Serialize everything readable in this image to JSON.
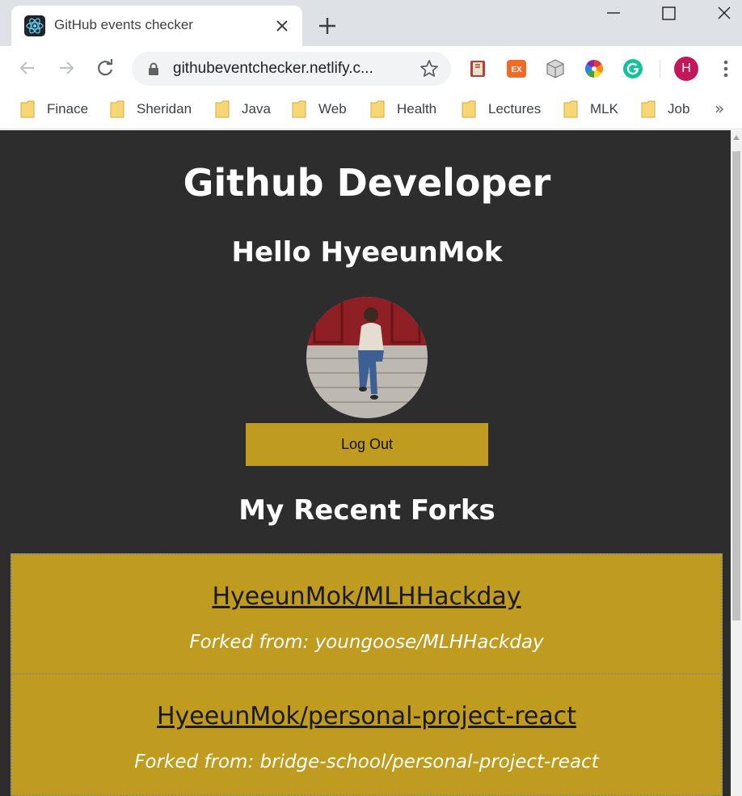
{
  "browser": {
    "tab_title": "GitHub events checker",
    "url": "githubeventchecker.netlify.c...",
    "profile_initial": "H",
    "bookmarks": [
      "Finace",
      "Sheridan",
      "Java",
      "Web",
      "Health",
      "Lectures",
      "MLK",
      "Job"
    ],
    "bookmarks_overflow": "»"
  },
  "page": {
    "title": "Github Developer",
    "greeting": "Hello HyeeunMok",
    "logout_label": "Log Out",
    "section_title": "My Recent Forks",
    "forks": [
      {
        "repo": "HyeeunMok/MLHHackday",
        "forked_from": "Forked from: youngoose/MLHHackday"
      },
      {
        "repo": "HyeeunMok/personal-project-react",
        "forked_from": "Forked from: bridge-school/personal-project-react"
      }
    ]
  },
  "colors": {
    "page_bg": "#2d2d2d",
    "accent": "#bf9b1f",
    "avatar": "#c2185b"
  }
}
